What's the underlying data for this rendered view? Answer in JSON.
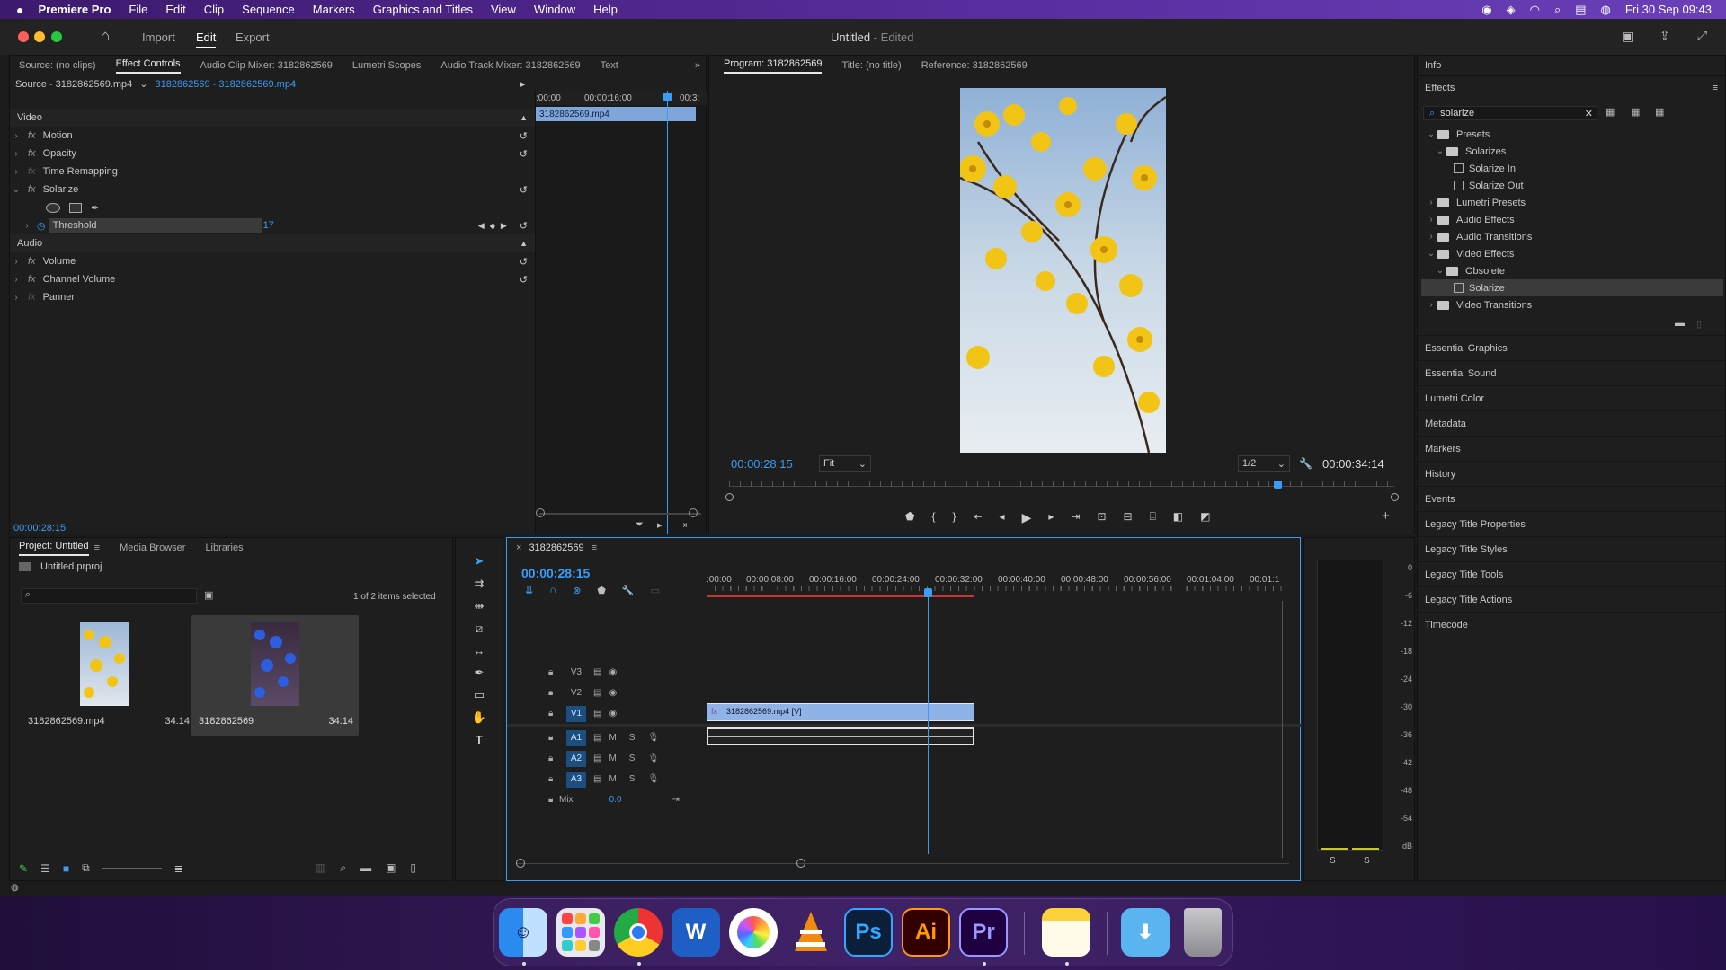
{
  "menubar": {
    "app": "Premiere Pro",
    "items": [
      "File",
      "Edit",
      "Clip",
      "Sequence",
      "Markers",
      "Graphics and Titles",
      "View",
      "Window",
      "Help"
    ],
    "clock": "Fri 30 Sep  09:43"
  },
  "appbar": {
    "tabs": [
      "Import",
      "Edit",
      "Export"
    ],
    "title": "Untitled",
    "subtitle": "- Edited"
  },
  "source_panel": {
    "tabs": [
      "Source: (no clips)",
      "Effect Controls",
      "Audio Clip Mixer: 3182862569",
      "Lumetri Scopes",
      "Audio Track Mixer: 3182862569",
      "Text"
    ],
    "source_label": "Source - 3182862569.mp4",
    "sequence_label": "3182862569 - 3182862569.mp4",
    "ruler": [
      ":00:00",
      "00:00:16:00",
      "00:3:"
    ],
    "clip_name": "3182862569.mp4",
    "video_header": "Video",
    "audio_header": "Audio",
    "video_effects": [
      "Motion",
      "Opacity",
      "Time Remapping",
      "Solarize"
    ],
    "threshold_label": "Threshold",
    "threshold_value": "17",
    "audio_effects": [
      "Volume",
      "Channel Volume",
      "Panner"
    ],
    "timecode": "00:00:28:15"
  },
  "program": {
    "tabs": [
      "Program: 3182862569",
      "Title: (no title)",
      "Reference: 3182862569"
    ],
    "timecode": "00:00:28:15",
    "fit": "Fit",
    "resolution": "1/2",
    "duration": "00:00:34:14"
  },
  "effects_panel": {
    "info": "Info",
    "title": "Effects",
    "search": "solarize",
    "tree": [
      {
        "label": "Presets",
        "level": 0,
        "type": "folder",
        "open": true
      },
      {
        "label": "Solarizes",
        "level": 1,
        "type": "folder",
        "open": true
      },
      {
        "label": "Solarize In",
        "level": 2,
        "type": "preset"
      },
      {
        "label": "Solarize Out",
        "level": 2,
        "type": "preset"
      },
      {
        "label": "Lumetri Presets",
        "level": 0,
        "type": "folder"
      },
      {
        "label": "Audio Effects",
        "level": 0,
        "type": "folder"
      },
      {
        "label": "Audio Transitions",
        "level": 0,
        "type": "folder"
      },
      {
        "label": "Video Effects",
        "level": 0,
        "type": "folder",
        "open": true
      },
      {
        "label": "Obsolete",
        "level": 1,
        "type": "folder",
        "open": true
      },
      {
        "label": "Solarize",
        "level": 2,
        "type": "preset",
        "selected": true
      },
      {
        "label": "Video Transitions",
        "level": 0,
        "type": "folder"
      }
    ],
    "panels": [
      "Essential Graphics",
      "Essential Sound",
      "Lumetri Color",
      "Metadata",
      "Markers",
      "History",
      "Events",
      "Legacy Title Properties",
      "Legacy Title Styles",
      "Legacy Title Tools",
      "Legacy Title Actions",
      "Timecode"
    ]
  },
  "project": {
    "tabs": [
      "Project: Untitled",
      "Media Browser",
      "Libraries"
    ],
    "file": "Untitled.prproj",
    "selection": "1 of 2 items selected",
    "items": [
      {
        "name": "3182862569.mp4",
        "duration": "34:14"
      },
      {
        "name": "3182862569",
        "duration": "34:14"
      }
    ]
  },
  "timeline": {
    "name": "3182862569",
    "timecode": "00:00:28:15",
    "ruler": [
      ":00:00",
      "00:00:08:00",
      "00:00:16:00",
      "00:00:24:00",
      "00:00:32:00",
      "00:00:40:00",
      "00:00:48:00",
      "00:00:56:00",
      "00:01:04:00",
      "00:01:1"
    ],
    "video_tracks": [
      "V3",
      "V2",
      "V1"
    ],
    "audio_tracks": [
      "A1",
      "A2",
      "A3"
    ],
    "mix_label": "Mix",
    "mix_value": "0.0",
    "clip_label": "3182862569.mp4 [V]"
  },
  "meter": {
    "scale": [
      "0",
      "-6",
      "-12",
      "-18",
      "-24",
      "-30",
      "-36",
      "-42",
      "-48",
      "-54",
      "dB"
    ],
    "solo": [
      "S",
      "S"
    ]
  },
  "dock": [
    {
      "name": "Finder"
    },
    {
      "name": "Launchpad"
    },
    {
      "name": "Chrome"
    },
    {
      "name": "Word",
      "glyph": "W"
    },
    {
      "name": "Photos"
    },
    {
      "name": "VLC"
    },
    {
      "name": "Photoshop",
      "glyph": "Ps"
    },
    {
      "name": "Illustrator",
      "glyph": "Ai"
    },
    {
      "name": "Premiere",
      "glyph": "Pr"
    },
    {
      "name": "Notes"
    },
    {
      "name": "Downloads"
    },
    {
      "name": "Trash"
    }
  ],
  "colors": {
    "accent": "#3b9cf5",
    "clip": "#8fb3e6",
    "menubar": "#4a2590"
  }
}
